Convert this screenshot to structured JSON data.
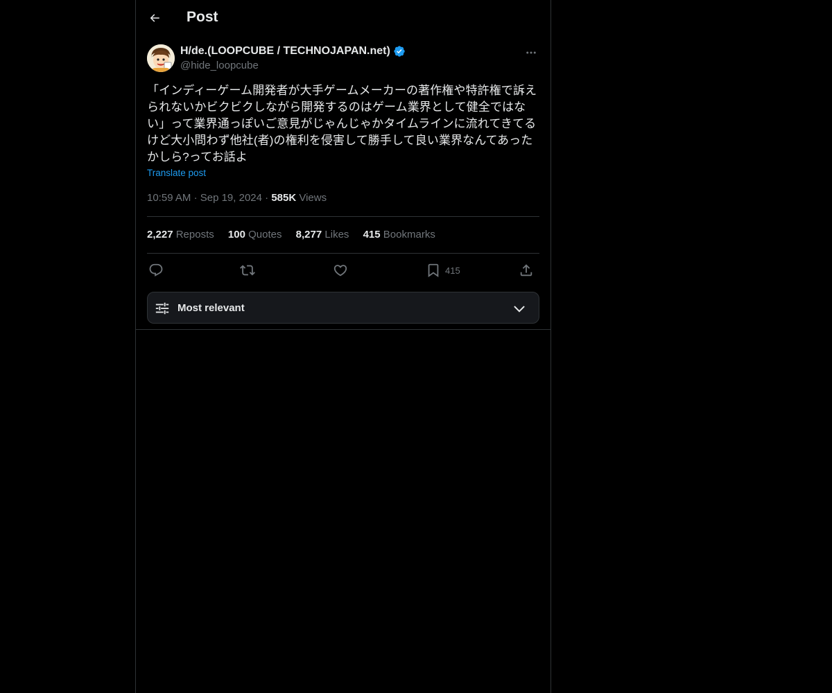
{
  "header": {
    "title": "Post"
  },
  "author": {
    "name": "H/de.(LOOPCUBE / TECHNOJAPAN.net)",
    "handle": "@hide_loopcube",
    "verified_color": "#1d9bf0"
  },
  "post": {
    "text": "「インディーゲーム開発者が大手ゲームメーカーの著作権や特許権で訴え\nられないかビクビクしながら開発するのはゲーム業界として健全ではな\nい」って業界通っぽいご意見がじゃんじゃかタイムラインに流れてきてる\nけど大小問わず他社(者)の権利を侵害して勝手して良い業界なんてあった\nかしら?ってお話よ",
    "translate_label": "Translate post",
    "time": "10:59 AM",
    "date": "Sep 19, 2024",
    "views_count": "585K",
    "views_label": "Views"
  },
  "stats": {
    "reposts_count": "2,227",
    "reposts_label": "Reposts",
    "quotes_count": "100",
    "quotes_label": "Quotes",
    "likes_count": "8,277",
    "likes_label": "Likes",
    "bookmarks_count": "415",
    "bookmarks_label": "Bookmarks"
  },
  "actions": {
    "reply_icon": "reply-icon",
    "repost_icon": "repost-icon",
    "like_icon": "heart-icon",
    "bookmark_icon": "bookmark-icon",
    "bookmark_count": "415",
    "share_icon": "share-icon"
  },
  "sort": {
    "label": "Most relevant"
  },
  "colors": {
    "background": "#000000",
    "text": "#e7e9ea",
    "muted": "#71767b",
    "accent": "#1d9bf0",
    "border": "#2f3336"
  }
}
